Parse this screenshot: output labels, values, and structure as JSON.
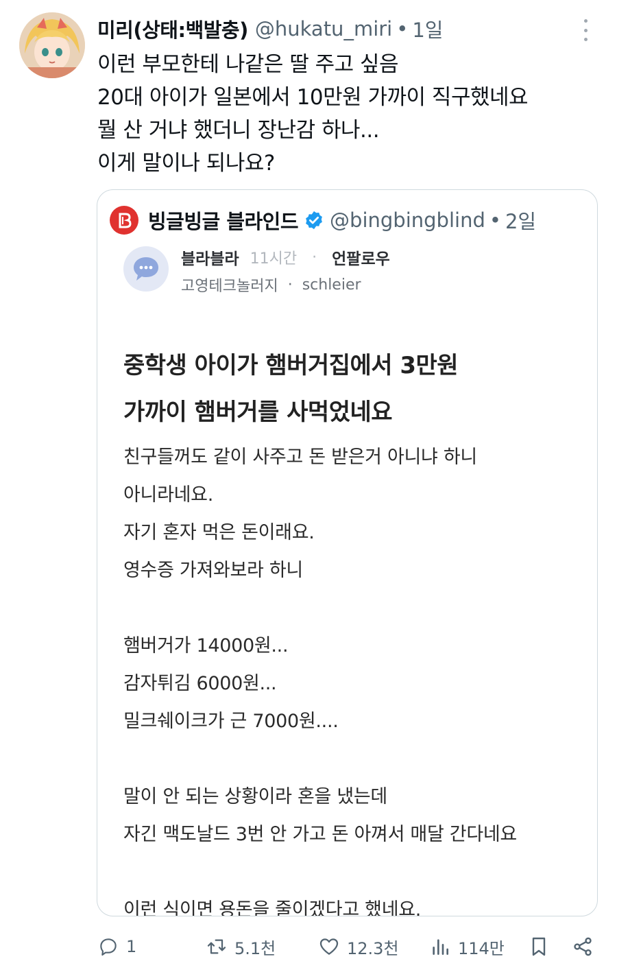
{
  "tweet": {
    "author_name": "미리(상태:백발충)",
    "author_handle": "@hukatu_miri",
    "separator": "•",
    "time_ago": "1일",
    "text_lines": [
      "이런 부모한테 나같은 딸 주고 싶음",
      "20대 아이가 일본에서 10만원 가까이 직구했네요",
      "뭘 산 거냐 했더니 장난감 하나...",
      "이게 말이나 되나요?"
    ]
  },
  "quote": {
    "account_name": "빙글빙글 블라인드",
    "account_handle": "@bingbingblind",
    "separator": "•",
    "time_ago": "2일",
    "post": {
      "category": "블라블라",
      "posted_ago": "11시간",
      "meta_separator": "·",
      "unfollow_label": "언팔로우",
      "company": "고영테크놀러지",
      "author": "schleier",
      "title_lines": [
        "중학생 아이가 햄버거집에서 3만원",
        "가까이 햄버거를 사먹었네요"
      ],
      "body_lines": [
        "친구들꺼도 같이 사주고 돈 받은거 아니냐 하니",
        "아니라네요.",
        "자기 혼자 먹은 돈이래요.",
        "영수증 가져와보라 하니",
        "",
        "햄버거가 14000원...",
        "감자튀김 6000원...",
        "밀크쉐이크가 근 7000원....",
        "",
        "말이 안 되는 상황이라 혼을 냈는데",
        "자긴 맥도날드 3번 안 가고 돈 아껴서 매달 간다네요",
        "",
        "이런 식이면 용돈을 줄이겠다고 했네요."
      ]
    }
  },
  "actions": {
    "reply_count": "1",
    "retweet_count": "5.1천",
    "like_count": "12.3천",
    "view_count": "114만"
  },
  "colors": {
    "text_primary": "#0f1419",
    "text_secondary": "#536471",
    "border": "#cfd9de",
    "verified_blue": "#1d9bf0",
    "brand_red": "#e0322f"
  },
  "icons": {
    "more": "more-vertical-icon",
    "verified": "verified-badge-icon",
    "brand_logo": "blind-logo-icon",
    "category_bubble": "chat-bubble-icon",
    "reply": "reply-icon",
    "retweet": "retweet-icon",
    "like": "heart-icon",
    "views": "views-chart-icon",
    "bookmark": "bookmark-icon",
    "share": "share-icon"
  }
}
